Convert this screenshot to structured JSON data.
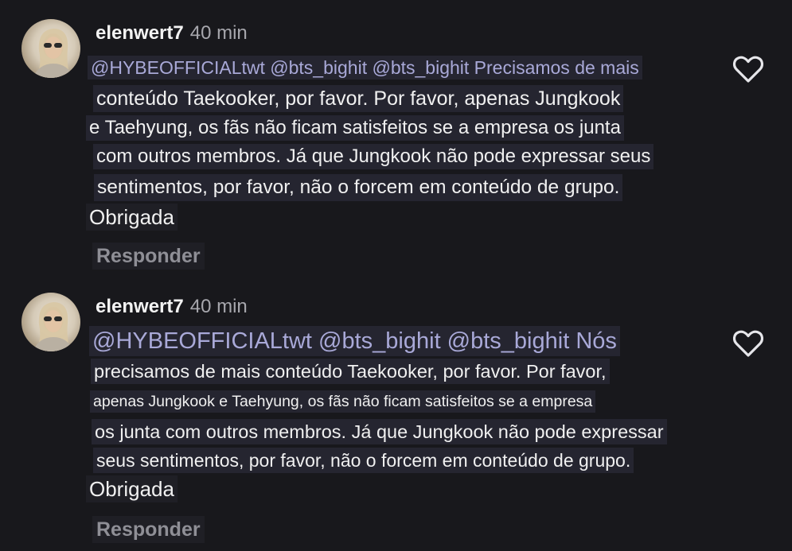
{
  "comments": [
    {
      "username": "elenwert7",
      "time": "40 min",
      "lines": [
        "@HYBEOFFICIALtwt @bts_bighit @bts_bighit Precisamos de mais",
        "conteúdo Taekooker, por favor. Por favor, apenas Jungkook",
        "e Taehyung, os fãs não ficam satisfeitos se a empresa os junta",
        "com outros membros. Já que Jungkook não pode expressar seus",
        "sentimentos, por favor, não o forcem em conteúdo de grupo.",
        "Obrigada"
      ],
      "reply_label": "Responder",
      "like_icon": "heart-outline-icon"
    },
    {
      "username": "elenwert7",
      "time": "40 min",
      "lines": [
        "@HYBEOFFICIALtwt @bts_bighit @bts_bighit Nós",
        "precisamos de mais conteúdo Taekooker, por favor. Por favor,",
        "apenas Jungkook e Taehyung, os fãs não ficam satisfeitos se a empresa",
        "os junta com outros membros. Já que Jungkook não pode expressar",
        "seus sentimentos, por favor, não o forcem em conteúdo de grupo.",
        "Obrigada"
      ],
      "reply_label": "Responder",
      "like_icon": "heart-outline-icon"
    }
  ],
  "colors": {
    "background": "#18181c",
    "text": "#f0f0f0",
    "mention": "#a9a9d8",
    "muted": "#8f8f96"
  }
}
